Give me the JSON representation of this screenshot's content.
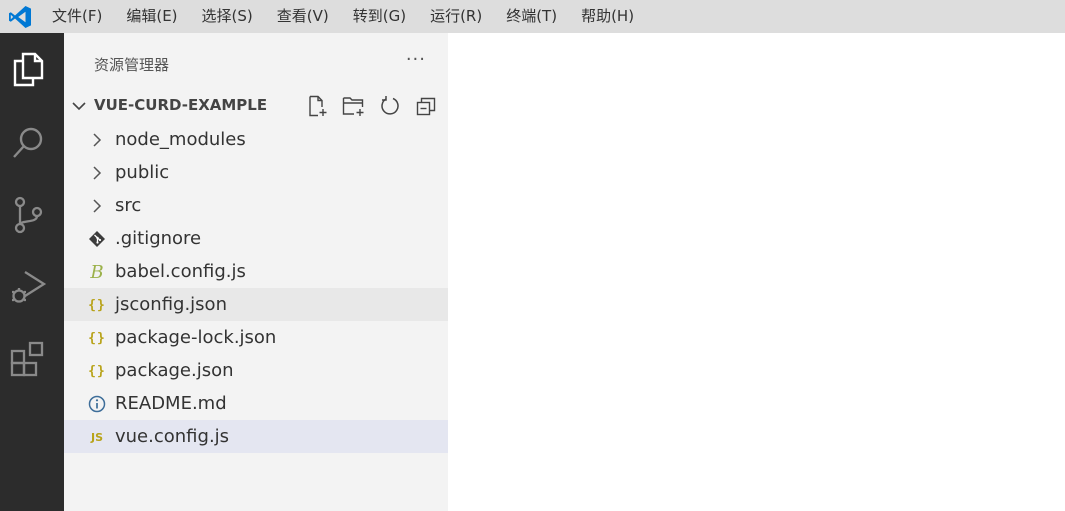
{
  "menubar": {
    "items": [
      "文件(F)",
      "编辑(E)",
      "选择(S)",
      "查看(V)",
      "转到(G)",
      "运行(R)",
      "终端(T)",
      "帮助(H)"
    ]
  },
  "activitybar": {
    "icons": [
      "explorer-icon",
      "search-icon",
      "source-control-icon",
      "run-debug-icon",
      "extensions-icon"
    ]
  },
  "sidebar": {
    "title": "资源管理器",
    "more": "···",
    "folder": {
      "name": "VUE-CURD-EXAMPLE",
      "actions": [
        "new-file-icon",
        "new-folder-icon",
        "refresh-icon",
        "collapse-all-icon"
      ]
    },
    "tree": [
      {
        "label": "node_modules",
        "type": "folder"
      },
      {
        "label": "public",
        "type": "folder"
      },
      {
        "label": "src",
        "type": "folder"
      },
      {
        "label": ".gitignore",
        "type": "git"
      },
      {
        "label": "babel.config.js",
        "type": "babel"
      },
      {
        "label": "jsconfig.json",
        "type": "json",
        "state": "hover"
      },
      {
        "label": "package-lock.json",
        "type": "json"
      },
      {
        "label": "package.json",
        "type": "json"
      },
      {
        "label": "README.md",
        "type": "info"
      },
      {
        "label": "vue.config.js",
        "type": "js",
        "state": "selected"
      }
    ]
  },
  "colors": {
    "menubar_bg": "#dddddd",
    "activitybar_bg": "#2c2c2c",
    "sidebar_bg": "#f3f3f3",
    "vscode_blue": "#0078d4",
    "json_yellow": "#b8a31a",
    "selected_bg": "#e4e6f1"
  }
}
